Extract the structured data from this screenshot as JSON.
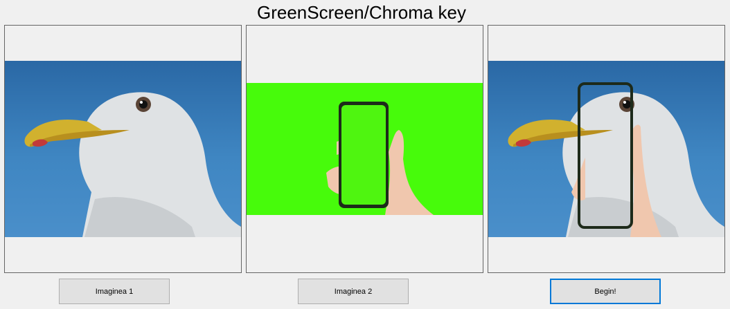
{
  "window": {
    "title": "GreenScreen/Chroma key"
  },
  "pictures": [
    {
      "name": "seagull-image",
      "icon": "seagull-photo"
    },
    {
      "name": "phone-green-screen-image",
      "icon": "hand-holding-phone-photo",
      "background": "#47fb0b"
    },
    {
      "name": "composite-result-image",
      "icon": "seagull-with-phone-overlay-photo"
    }
  ],
  "buttons": {
    "image1_label": "Imaginea 1",
    "image2_label": "Imaginea 2",
    "begin_label": "Begin!"
  },
  "colors": {
    "background": "#f0f0f0",
    "chroma_green": "#47fb0b",
    "sky_blue": "#3a7ebd",
    "focus_border": "#0078d7"
  }
}
